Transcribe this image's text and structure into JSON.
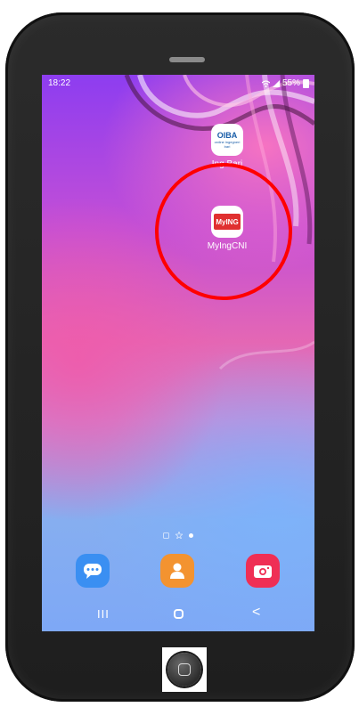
{
  "status_bar": {
    "time": "18:22",
    "battery": "55%"
  },
  "home_screen": {
    "apps": [
      {
        "label": "Ing Bari",
        "icon_text": "OIBA",
        "icon_subtext": "ordine ingegneri bari"
      },
      {
        "label": "MyIngCNI",
        "icon_text": "MyING"
      }
    ],
    "highlight_color": "#ff0000"
  },
  "page_indicator": {
    "current_page": 2,
    "pages": 3
  },
  "dock": {
    "items": [
      {
        "name": "messages",
        "color": "#3a8ff2"
      },
      {
        "name": "contacts",
        "color": "#f39330"
      },
      {
        "name": "camera",
        "color": "#ef2f55"
      }
    ]
  },
  "nav_bar": {
    "recents_glyph": "III",
    "back_glyph": "<"
  }
}
